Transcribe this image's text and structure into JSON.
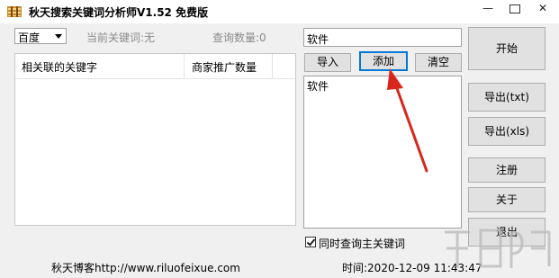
{
  "window": {
    "title": "秋天搜索关键词分析师V1.52 免费版",
    "controls": {
      "minimize": "—",
      "close": "✕"
    }
  },
  "search": {
    "engine_selected": "百度",
    "current_keyword": "当前关键词:无",
    "query_count": "查询数量:0"
  },
  "results_table": {
    "columns": [
      "相关联的关键字",
      "商家推广数量"
    ],
    "rows": []
  },
  "keyword_input": {
    "value": "软件"
  },
  "actions": {
    "import": "导入",
    "add": "添加",
    "clear": "清空"
  },
  "keyword_list": {
    "content": "软件"
  },
  "option": {
    "checked": true,
    "label": "同时查询主关键词"
  },
  "side_buttons": {
    "start": "开始",
    "export_txt": "导出(txt)",
    "export_xls": "导出(xls)",
    "register": "注册",
    "about": "关于",
    "exit": "退出"
  },
  "status_bar": {
    "blog": "秋天博客http://www.riluofeixue.com",
    "time": "时间:2020-12-09 11:43:47"
  },
  "colors": {
    "annotation_arrow": "#d9261c",
    "focus_border": "#0078d7"
  }
}
